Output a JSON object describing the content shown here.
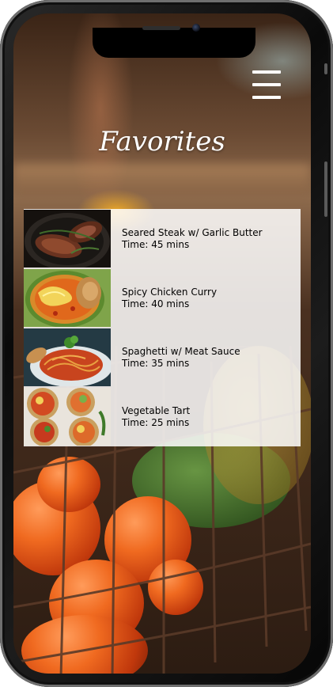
{
  "header": {
    "title": "Favorites",
    "menu_icon": "hamburger-menu-icon"
  },
  "favorites": [
    {
      "name": "Seared Steak w/ Garlic Butter",
      "time": "Time: 45 mins",
      "image": "steak-photo"
    },
    {
      "name": "Spicy Chicken Curry",
      "time": "Time: 40 mins",
      "image": "chicken-curry-photo"
    },
    {
      "name": "Spaghetti w/ Meat Sauce",
      "time": "Time: 35 mins",
      "image": "spaghetti-photo"
    },
    {
      "name": "Vegetable Tart",
      "time": "Time: 25 mins",
      "image": "vegetable-tart-photo"
    }
  ],
  "colors": {
    "title_text": "#ffffff",
    "list_panel": "#ffffff",
    "item_text": "#000000"
  }
}
